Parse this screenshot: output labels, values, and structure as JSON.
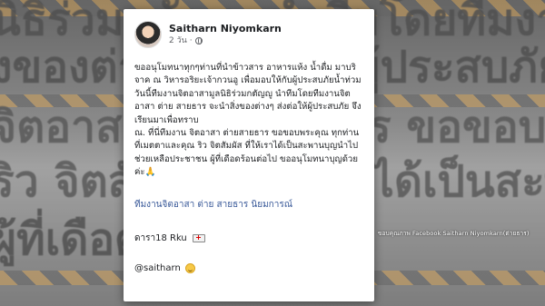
{
  "background": {
    "lines": [
      "นิธิร่วมกตัญญู นำทีมโดยทีมงานจิตอา",
      "งของต่างๆ ส่งต่อให้ผู้ประสบภัย จึงเรีย",
      "จิตอาสา ต่ายสายธาร ขอขอบพระคุณ ทุ",
      "ริว จิตสัมผัส ที่ให้เราได้เป็นสะพานบุญ",
      "ผู้ที่เดือดร้อนต่อไป"
    ]
  },
  "post": {
    "author_name": "Saitharn Niyomkarn",
    "timestamp": "2 วัน",
    "privacy_separator": "·",
    "body_paragraphs": [
      "ขออนุโมทนาทุกๆท่านที่นำข้าวสาร อาหารแห้ง น้ำดื่ม มาบริจาค ณ วิหารอริยะเจ้ากวนอู เพื่อมอบให้กับผู้ประสบภัยน้ำท่วม วันนี้ทีมงานจิตอาสามูลนิธิร่วมกตัญญู นำทีมโดยทีมงานจิตอาสา ต่าย สายธาร จะนำสิ่งของต่างๆ ส่งต่อให้ผู้ประสบภัย จึงเรียนมาเพื่อทราบ",
      "ณ. ที่นี่ทีมงาน จิตอาสา ต่ายสายธาร ขอขอบพระคุณ ทุกท่านที่เมตตาและคุณ ริว จิตสัมผัส ที่ให้เราได้เป็นสะพานบุญนำไปช่วยเหลือประชาชน ผู้ที่เดือดร้อนต่อไป ขออนุโมทนาบุญด้วยค่ะ🙏"
    ],
    "signature_link": "ทีมงานจิตอาสา ต่าย สายธาร นิยมการณ์",
    "tag_text": "ดารา18 Rku",
    "handle_text": "@saitharn"
  },
  "credit_text": "ขอบคุณภาพ Facebook Saitharn Niyomkarn(ต่ายธาร)",
  "colors": {
    "link": "#385898",
    "text": "#1c1e21",
    "meta": "#65676b"
  },
  "icons": {
    "privacy": "globe-icon",
    "tag": "ambulance-icon",
    "handle": "smile-icon"
  }
}
